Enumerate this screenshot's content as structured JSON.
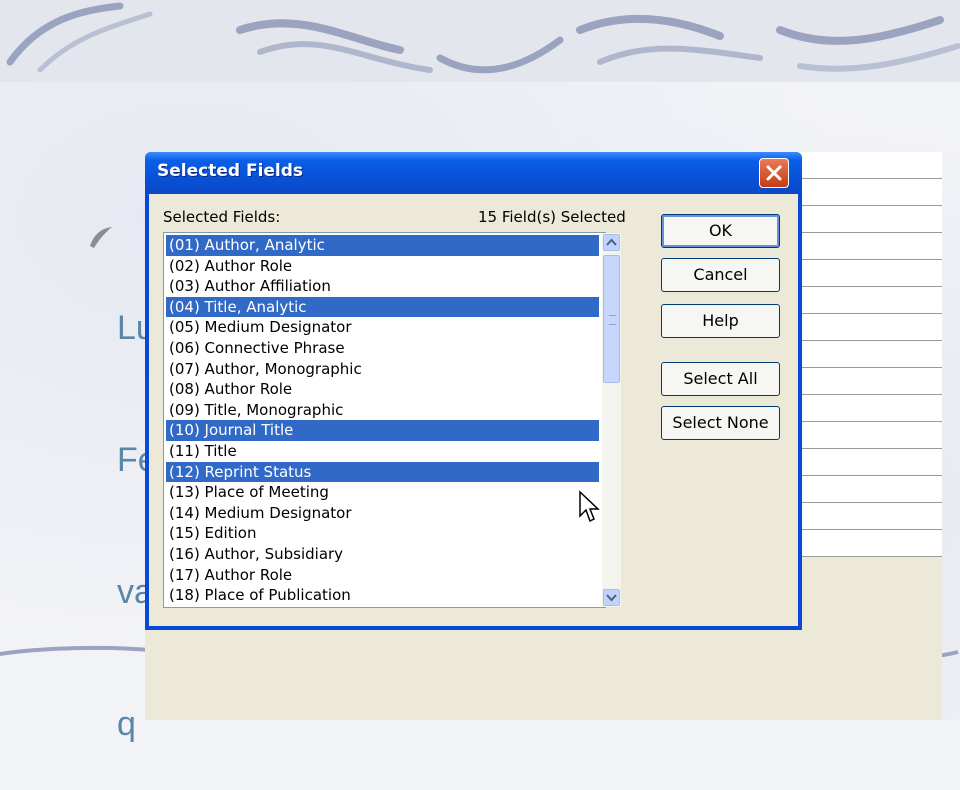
{
  "slide": {
    "bullet_lines": [
      "Lu",
      "Fe",
      "va",
      "q"
    ]
  },
  "dialog": {
    "title": "Selected Fields",
    "fields_label": "Selected Fields:",
    "count_label": "15 Field(s) Selected",
    "items": [
      {
        "label": "(01) Author, Analytic",
        "selected": true
      },
      {
        "label": "(02) Author Role",
        "selected": false
      },
      {
        "label": "(03) Author Affiliation",
        "selected": false
      },
      {
        "label": "(04) Title, Analytic",
        "selected": true
      },
      {
        "label": "(05) Medium Designator",
        "selected": false
      },
      {
        "label": "(06) Connective Phrase",
        "selected": false
      },
      {
        "label": "(07) Author, Monographic",
        "selected": false
      },
      {
        "label": "(08) Author Role",
        "selected": false
      },
      {
        "label": "(09) Title, Monographic",
        "selected": false
      },
      {
        "label": "(10) Journal Title",
        "selected": true
      },
      {
        "label": "(11) Title",
        "selected": false
      },
      {
        "label": "(12) Reprint Status",
        "selected": true
      },
      {
        "label": "(13) Place of Meeting",
        "selected": false
      },
      {
        "label": "(14) Medium Designator",
        "selected": false
      },
      {
        "label": "(15) Edition",
        "selected": false
      },
      {
        "label": "(16) Author, Subsidiary",
        "selected": false
      },
      {
        "label": "(17) Author Role",
        "selected": false
      },
      {
        "label": "(18) Place of Publication",
        "selected": false
      }
    ],
    "buttons": {
      "ok": "OK",
      "cancel": "Cancel",
      "help": "Help",
      "select_all": "Select All",
      "select_none": "Select None"
    }
  },
  "colors": {
    "title_bar": "#0a5fe6",
    "selection": "#3169c6",
    "close_button": "#c63b14",
    "bullet_text": "#5a86a8"
  },
  "icons": [
    "close-icon",
    "scroll-up-icon",
    "scroll-down-icon",
    "mouse-pointer-icon",
    "bullet-icon"
  ]
}
